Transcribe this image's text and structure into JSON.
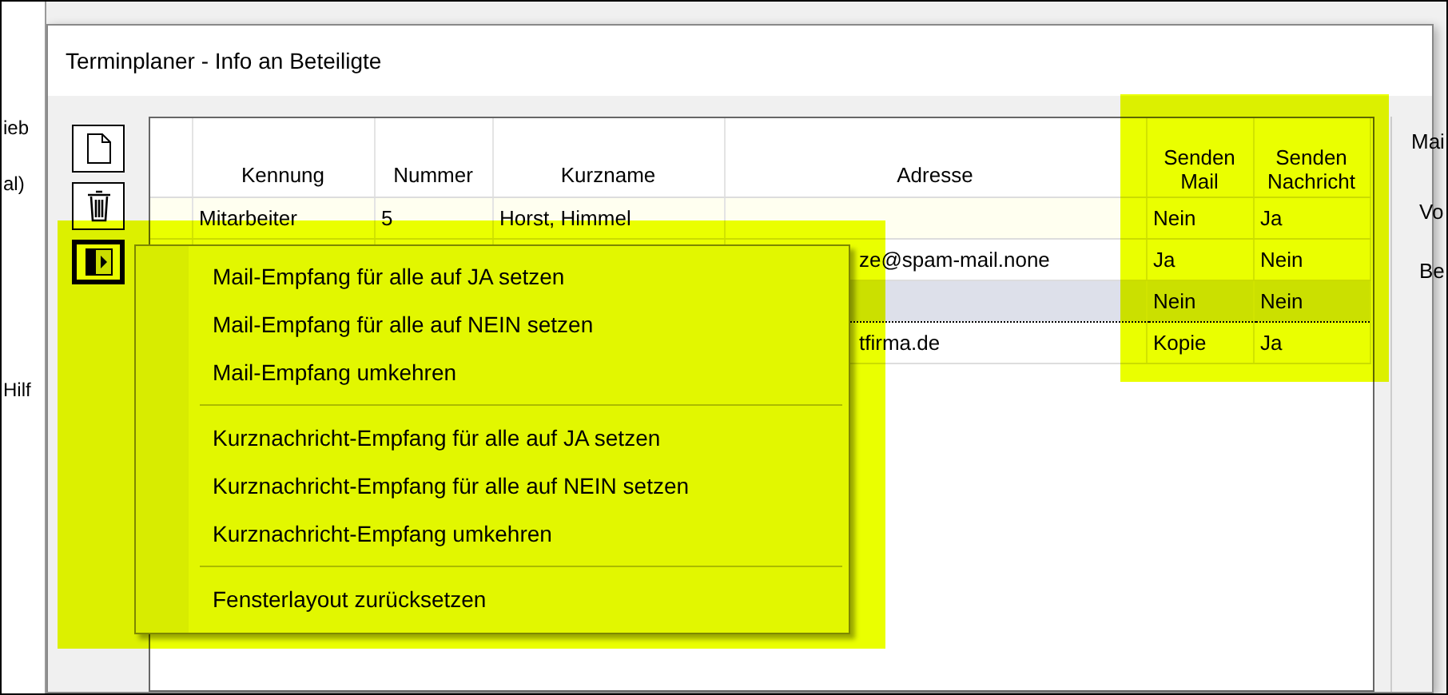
{
  "background_window": {
    "left_fragments": [
      "ieb",
      "al)",
      "Hilf"
    ]
  },
  "window": {
    "title": "Terminplaner - Info an Beteiligte"
  },
  "toolbar": [
    {
      "kind": "new"
    },
    {
      "kind": "delete"
    },
    {
      "kind": "menu",
      "pressed": true
    }
  ],
  "table": {
    "columns": [
      "Kennung",
      "Nummer",
      "Kurzname",
      "Adresse",
      "Senden Mail",
      "Senden Nachricht"
    ],
    "rows": [
      {
        "kennung": "Mitarbeiter",
        "nummer": "5",
        "kurzname": "Horst, Himmel",
        "senden_mail": "Nein",
        "senden_nachricht": "Ja",
        "selected": false,
        "current": true
      },
      {
        "adresse": "ze@spam-mail.none",
        "senden_mail": "Ja",
        "senden_nachricht": "Nein",
        "selected": false,
        "current": false
      },
      {
        "senden_mail": "Nein",
        "senden_nachricht": "Nein",
        "selected": true,
        "current": false
      },
      {
        "adresse": "tfirma.de",
        "senden_mail": "Kopie",
        "senden_nachricht": "Ja",
        "selected": false,
        "current": false
      }
    ]
  },
  "right_panel": {
    "fragments": [
      "Mai",
      "Vo",
      "Be"
    ]
  },
  "context_menu": {
    "items": [
      {
        "kind": "item",
        "label": "Mail-Empfang für alle auf JA setzen"
      },
      {
        "kind": "item",
        "label": "Mail-Empfang für alle auf NEIN setzen"
      },
      {
        "kind": "item",
        "label": "Mail-Empfang umkehren"
      },
      {
        "kind": "separator"
      },
      {
        "kind": "item",
        "label": "Kurznachricht-Empfang für alle auf JA setzen"
      },
      {
        "kind": "item",
        "label": "Kurznachricht-Empfang für alle auf NEIN setzen"
      },
      {
        "kind": "item",
        "label": "Kurznachricht-Empfang umkehren"
      },
      {
        "kind": "separator"
      },
      {
        "kind": "item",
        "label": "Fensterlayout zurücksetzen"
      }
    ]
  }
}
